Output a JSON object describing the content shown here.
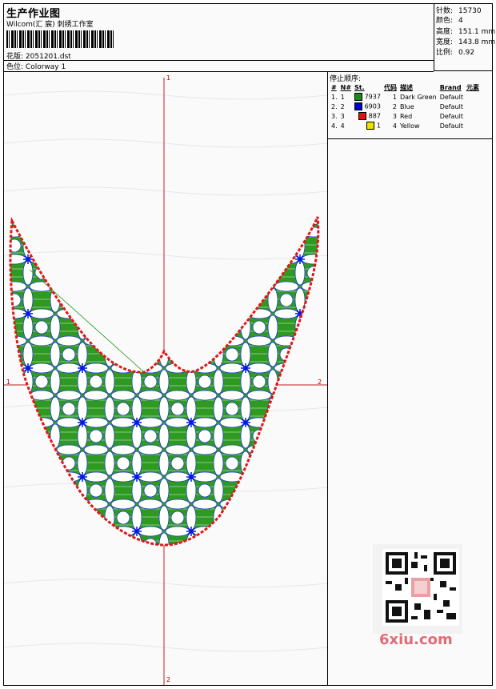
{
  "header": {
    "title": "生产作业图",
    "studio": "Wilcom(汇 宸) 刺绣工作室",
    "file_label": "花版:",
    "file_name": "2051201.dst",
    "colorway_label": "色位:",
    "colorway_name": "Colorway 1"
  },
  "stats": [
    {
      "label": "针数:",
      "value": "15730"
    },
    {
      "label": "颜色:",
      "value": "4"
    },
    {
      "label": "高度:",
      "value": "151.1 mm"
    },
    {
      "label": "宽度:",
      "value": "143.8 mm"
    },
    {
      "label": "比例:",
      "value": "0.92"
    }
  ],
  "stop_sequence": {
    "title": "停止顺序:",
    "columns": [
      "#",
      "N#",
      "St.",
      "代码",
      "描述",
      "Brand",
      "元素"
    ],
    "rows": [
      {
        "index": "1.",
        "n": "1",
        "color": "#1a8a1a",
        "stitches": "7937",
        "code": "1",
        "description": "Dark Green",
        "brand": "Default"
      },
      {
        "index": "2.",
        "n": "2",
        "color": "#0000cc",
        "stitches": "6903",
        "code": "2",
        "description": "Blue",
        "brand": "Default"
      },
      {
        "index": "3.",
        "n": "3",
        "color": "#e01010",
        "stitches": "887",
        "code": "3",
        "description": "Red",
        "brand": "Default"
      },
      {
        "index": "4.",
        "n": "4",
        "color": "#f0e000",
        "stitches": "1",
        "code": "4",
        "description": "Yellow",
        "brand": "Default"
      }
    ]
  },
  "axes": {
    "top": "1",
    "bottom": "2",
    "left": "1",
    "right": "2"
  },
  "watermark": {
    "site": "6xiu.com"
  }
}
